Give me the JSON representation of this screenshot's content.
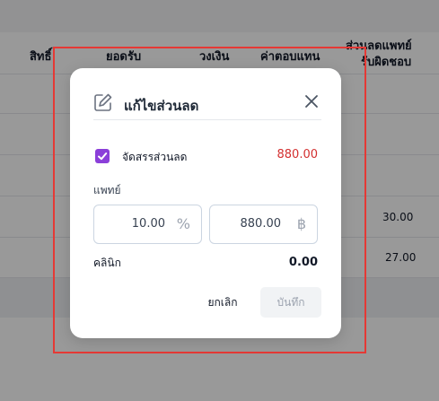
{
  "table": {
    "headers": [
      "สิทธิ์",
      "ยอดรับ",
      "วงเงิน",
      "ค่าตอบแทน",
      "ส่วนลดแพทย์",
      "รับผิดชอบ"
    ],
    "rows": [
      {
        "value": ""
      },
      {
        "value": ""
      },
      {
        "value": ""
      },
      {
        "value": "30.00"
      },
      {
        "value": "27.00"
      }
    ]
  },
  "dialog": {
    "title": "แก้ไขส่วนลด",
    "title_icon": "edit-icon",
    "close_icon": "close-icon",
    "checkbox_label": "จัดสรรส่วนลด",
    "checkbox_checked": true,
    "allocated_amount": "880.00",
    "doctor_label": "แพทย์",
    "percent_value": "10.00",
    "percent_unit": "%",
    "amount_value": "880.00",
    "amount_unit": "฿",
    "clinic_label": "คลินิก",
    "clinic_value": "0.00",
    "cancel_label": "ยกเลิก",
    "save_label": "บันทึก"
  },
  "colors": {
    "accent": "#8b3fd9",
    "danger": "#d32f2f",
    "highlight": "#e53935"
  }
}
